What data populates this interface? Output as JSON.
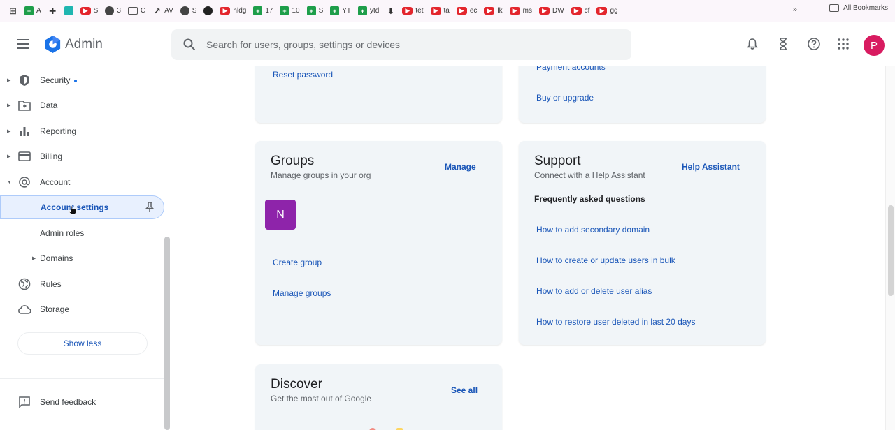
{
  "bookmarks": {
    "items": [
      {
        "label": "A",
        "icon": "sheets-icon"
      },
      {
        "label": "",
        "icon": "extension-icon"
      },
      {
        "label": "",
        "icon": "app-icon"
      },
      {
        "label": "S",
        "icon": "youtube-icon"
      },
      {
        "label": "3",
        "icon": "circle-icon"
      },
      {
        "label": "C",
        "icon": "folder-icon"
      },
      {
        "label": "AV",
        "icon": "trend-icon"
      },
      {
        "label": "S",
        "icon": "globe-icon"
      },
      {
        "label": "",
        "icon": "github-icon"
      },
      {
        "label": "hldg",
        "icon": "youtube-icon"
      },
      {
        "label": "17",
        "icon": "sheets-icon"
      },
      {
        "label": "10",
        "icon": "sheets-icon"
      },
      {
        "label": "S",
        "icon": "sheets-icon"
      },
      {
        "label": "YT",
        "icon": "sheets-icon"
      },
      {
        "label": "ytd",
        "icon": "sheets-icon"
      },
      {
        "label": "",
        "icon": "pin-icon"
      },
      {
        "label": "tet",
        "icon": "youtube-icon"
      },
      {
        "label": "ta",
        "icon": "youtube-icon"
      },
      {
        "label": "ec",
        "icon": "youtube-icon"
      },
      {
        "label": "lk",
        "icon": "youtube-icon"
      },
      {
        "label": "ms",
        "icon": "youtube-icon"
      },
      {
        "label": "DW",
        "icon": "youtube-icon"
      },
      {
        "label": "cf",
        "icon": "youtube-icon"
      },
      {
        "label": "gg",
        "icon": "youtube-icon"
      }
    ],
    "more": "»",
    "all_bookmarks": "All Bookmarks"
  },
  "header": {
    "app_title": "Admin",
    "search_placeholder": "Search for users, groups, settings or devices",
    "avatar_letter": "P"
  },
  "sidebar": {
    "items": [
      {
        "label": "Security"
      },
      {
        "label": "Data"
      },
      {
        "label": "Reporting"
      },
      {
        "label": "Billing"
      },
      {
        "label": "Account"
      },
      {
        "label": "Account settings"
      },
      {
        "label": "Admin roles"
      },
      {
        "label": "Domains"
      },
      {
        "label": "Rules"
      },
      {
        "label": "Storage"
      }
    ],
    "show_less": "Show less",
    "send_feedback": "Send feedback"
  },
  "cards": {
    "users_top": {
      "link": "Reset password"
    },
    "billing_top": {
      "link_1": "Payment accounts",
      "link_2": "Buy or upgrade"
    },
    "groups": {
      "title": "Groups",
      "subtitle": "Manage groups in your org",
      "action": "Manage",
      "avatar_letter": "N",
      "link_1": "Create group",
      "link_2": "Manage groups"
    },
    "support": {
      "title": "Support",
      "subtitle": "Connect with a Help Assistant",
      "action": "Help Assistant",
      "faq_title": "Frequently asked questions",
      "faqs": [
        "How to add secondary domain",
        "How to create or update users in bulk",
        "How to add or delete user alias",
        "How to restore user deleted in last 20 days"
      ]
    },
    "discover": {
      "title": "Discover",
      "subtitle": "Get the most out of Google",
      "action": "See all"
    }
  },
  "colors": {
    "accent": "#1a56b8",
    "avatar": "#d81b60",
    "group_avatar": "#8e24aa",
    "card_bg": "#f1f5f8"
  }
}
